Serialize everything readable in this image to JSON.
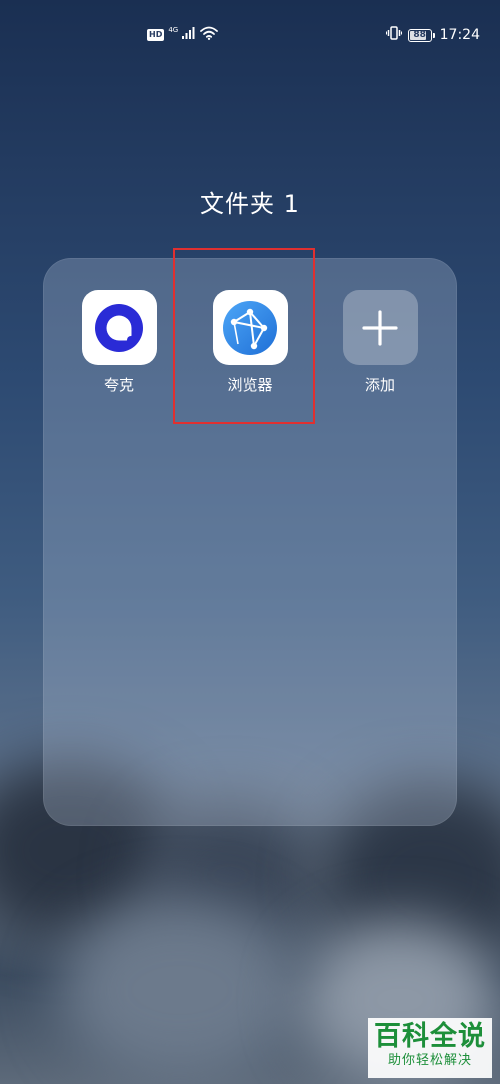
{
  "status_bar": {
    "hd_badge": "HD",
    "network_type": "4G",
    "battery_level": "88",
    "battery_percent": 88,
    "time": "17:24"
  },
  "folder": {
    "title": "文件夹 1",
    "apps": [
      {
        "label": "夸克",
        "icon": "quark-icon",
        "color": "#2a2bd6"
      },
      {
        "label": "浏览器",
        "icon": "browser-icon",
        "color": "#2f8ae9"
      },
      {
        "label": "添加",
        "icon": "plus-icon",
        "color": "#ffffff"
      }
    ]
  },
  "watermark": {
    "title": "百科全说",
    "subtitle": "助你轻松解决"
  },
  "colors": {
    "highlight": "#e03030",
    "watermark_green": "#1d8f3a"
  }
}
